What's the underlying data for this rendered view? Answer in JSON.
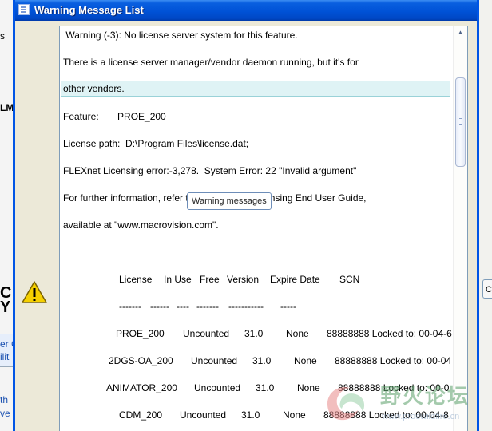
{
  "window": {
    "title": "Warning Message List"
  },
  "background": {
    "fragments": [
      "s",
      "LM",
      "C",
      "Y",
      "er C",
      "ilit",
      "th",
      "ve"
    ]
  },
  "message": {
    "lines": [
      " Warning (-3): No license server system for this feature.",
      "There is a license server manager/vendor daemon running, but it's for",
      "other vendors.",
      "Feature:       PROE_200",
      "License path:  D:\\Program Files\\license.dat;",
      "FLEXnet Licensing error:-3,278.  System Error: 22 \"Invalid argument\"",
      "For further information, refer to the FLEXnet Licensing End User Guide,",
      "available at \"www.macrovision.com\"."
    ],
    "table_header": {
      "license": "License",
      "in_use": "In Use",
      "free": "Free",
      "version": "Version",
      "expire": "Expire Date",
      "scn": "SCN"
    },
    "table_sep": {
      "license": "-------",
      "in_use": "------",
      "free": "----",
      "version": "-------",
      "expire": "-----------",
      "scn": "-----"
    },
    "rows": [
      {
        "license": "PROE_200",
        "in_use": "Uncounted",
        "version": "31.0",
        "expire": "None",
        "scn": "88888888 Locked to: 00-04-6"
      },
      {
        "license": "2DGS-OA_200",
        "in_use": "Uncounted",
        "version": "31.0",
        "expire": "None",
        "scn": "88888888 Locked to: 00-04"
      },
      {
        "license": "ANIMATOR_200",
        "in_use": "Uncounted",
        "version": "31.0",
        "expire": "None",
        "scn": "88888888 Locked to: 00-0"
      },
      {
        "license": "CDM_200",
        "in_use": "Uncounted",
        "version": "31.0",
        "expire": "None",
        "scn": "88888888 Locked to: 00-04-8"
      }
    ]
  },
  "tooltip": {
    "text": "Warning messages"
  },
  "watermark": {
    "text": "野火论坛",
    "url": "www.proewildfire.cn"
  },
  "colors": {
    "title_blue": "#0054e3",
    "highlight": "#dff3f5",
    "watermark_green": "#5aa06a"
  }
}
